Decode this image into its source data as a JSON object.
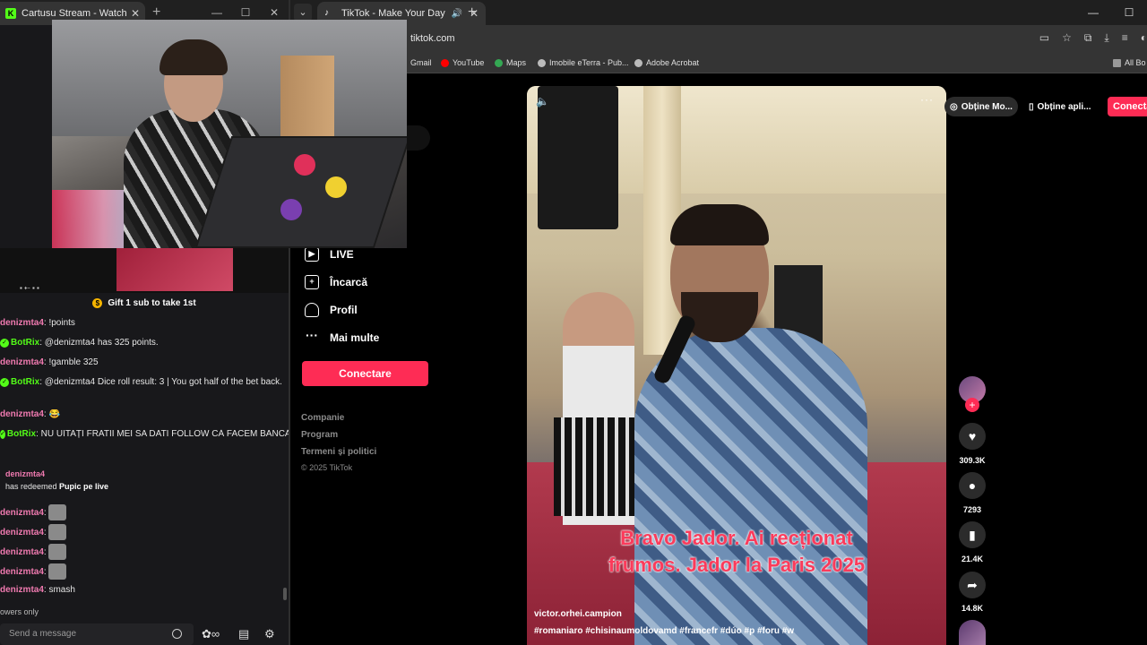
{
  "kick": {
    "tab_title": "Cartusu Stream - Watch Live on",
    "tab_favicon": "K",
    "pinned_gift": "Gift 1 sub to take 1st",
    "messages": [
      {
        "user": "denizmta4",
        "text": ": !points",
        "bot": false,
        "emote": false
      },
      {
        "user": "BotRix",
        "text": ": @denizmta4 has 325 points.",
        "bot": true,
        "emote": false
      },
      {
        "user": "denizmta4",
        "text": ": !gamble 325",
        "bot": false,
        "emote": false
      },
      {
        "user": "BotRix",
        "text": ": @denizmta4 Dice roll result: 3 | You got half of the bet back.",
        "bot": true,
        "emote": false
      },
      {
        "user": "denizmta4",
        "text": ": 😂",
        "bot": false,
        "emote": false
      },
      {
        "user": "BotRix",
        "text": ": NU UITAȚI FRATII MEI SA DATI FOLLOW CĂ FACEM BANCĂ",
        "bot": true,
        "emote": false
      }
    ],
    "redeem": {
      "user": "denizmta4",
      "prefix": "has redeemed ",
      "reward": "Pupic pe live"
    },
    "emote_messages": [
      {
        "user": "denizmta4",
        "text": ":"
      },
      {
        "user": "denizmta4",
        "text": ":"
      },
      {
        "user": "denizmta4",
        "text": ":"
      },
      {
        "user": "denizmta4",
        "text": ":"
      },
      {
        "user": "denizmta4",
        "text": ": smash"
      }
    ],
    "followers_only": "owers only",
    "chat_placeholder": "Send a message"
  },
  "tiktok": {
    "tab_title": "TikTok - Make Your Day",
    "url": "tiktok.com",
    "bookmarks": [
      "Gmail",
      "YouTube",
      "Maps",
      "Imobile eTerra - Pub...",
      "Adobe Acrobat",
      "All Bo"
    ],
    "nav": [
      "LIVE",
      "Încarcă",
      "Profil",
      "Mai multe"
    ],
    "connect_label": "Conectare",
    "footer": [
      "Companie",
      "Program",
      "Termeni și politici"
    ],
    "copyright": "© 2025 TikTok",
    "top_actions": {
      "get_more": "Obține Mo...",
      "get_app": "Obține apli...",
      "connect": "Conecta"
    },
    "video": {
      "caption_line1": "Bravo  Jador.  Ai recționat",
      "caption_line2": "frumos. Jador la Paris 2025",
      "author": "victor.orhei.campion",
      "tags": "#romaniaro  #chisinaumoldovamd  #francefr  #dúo  #p  #foru  #w"
    },
    "stats": {
      "likes": "309.3K",
      "comments": "7293",
      "saves": "21.4K",
      "shares": "14.8K"
    }
  },
  "colors": {
    "tiktok_pink": "#fe2c55",
    "kick_green": "#53fc18",
    "username_pink": "#f07ab0"
  }
}
